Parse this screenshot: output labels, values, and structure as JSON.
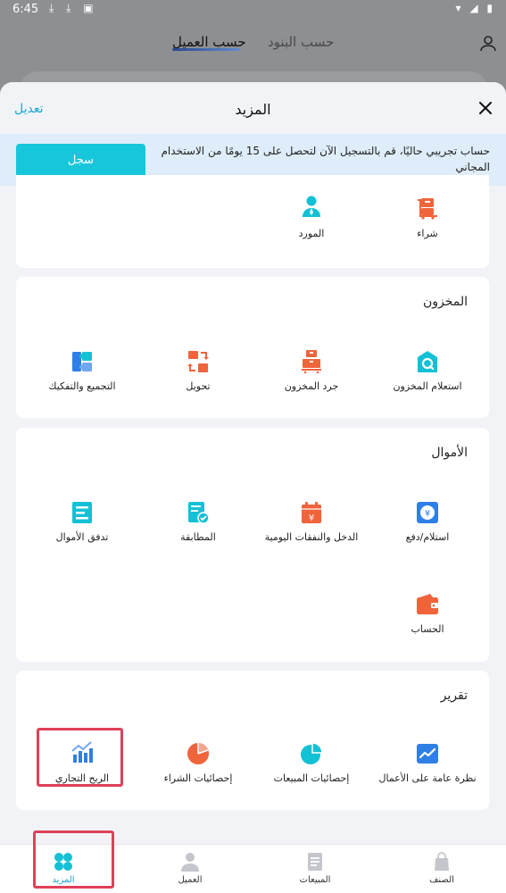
{
  "status_bar": {
    "time": "6:45"
  },
  "background_tabs": {
    "active": "حسب العميل",
    "inactive": "حسب البنود"
  },
  "sheet": {
    "title": "المزيد",
    "edit_label": "تعديل"
  },
  "trial": {
    "message": "حساب تجريبي حاليًا، قم بالتسجيل الآن لتحصل على 15 يومًا من الاستخدام المجاني",
    "register_label": "سجل"
  },
  "purchase_section": {
    "items": [
      {
        "label": "شراء",
        "icon": "purchase-cart-icon"
      },
      {
        "label": "المورد",
        "icon": "supplier-icon"
      }
    ]
  },
  "inventory_section": {
    "title": "المخزون",
    "items": [
      {
        "label": "استعلام المخزون",
        "icon": "inventory-query-icon"
      },
      {
        "label": "جرد المخزون",
        "icon": "stock-count-icon"
      },
      {
        "label": "تحويل",
        "icon": "transfer-icon"
      },
      {
        "label": "التجميع والتفكيك",
        "icon": "assembly-icon"
      }
    ]
  },
  "funds_section": {
    "title": "الأموال",
    "items": [
      {
        "label": "استلام/دفع",
        "icon": "receive-pay-icon"
      },
      {
        "label": "الدخل والنفقات اليومية",
        "icon": "daily-income-expense-icon"
      },
      {
        "label": "المطابقة",
        "icon": "reconciliation-icon"
      },
      {
        "label": "تدفق الأموال",
        "icon": "cash-flow-icon"
      },
      {
        "label": "الحساب",
        "icon": "account-wallet-icon"
      }
    ]
  },
  "report_section": {
    "title": "تقرير",
    "items": [
      {
        "label": "نظرة عامة على الأعمال",
        "icon": "business-overview-icon"
      },
      {
        "label": "إحصائيات المبيعات",
        "icon": "sales-stats-icon"
      },
      {
        "label": "إحصائيات الشراء",
        "icon": "purchase-stats-icon"
      },
      {
        "label": "الربح التجاري",
        "icon": "business-profit-icon"
      }
    ]
  },
  "bottom_nav": {
    "items": [
      {
        "label": "الصنف",
        "icon": "items-bag-icon"
      },
      {
        "label": "المبيعات",
        "icon": "sales-document-icon"
      },
      {
        "label": "العميل",
        "icon": "customer-icon"
      },
      {
        "label": "المزيد",
        "icon": "more-grid-icon"
      }
    ],
    "active": "المزيد"
  },
  "colors": {
    "accent": "#1aa7d6",
    "register_button": "#16c6da",
    "orange": "#f0643c",
    "cyan": "#12c1d5",
    "blue": "#2f7fe6",
    "highlight": "#e0405a"
  }
}
